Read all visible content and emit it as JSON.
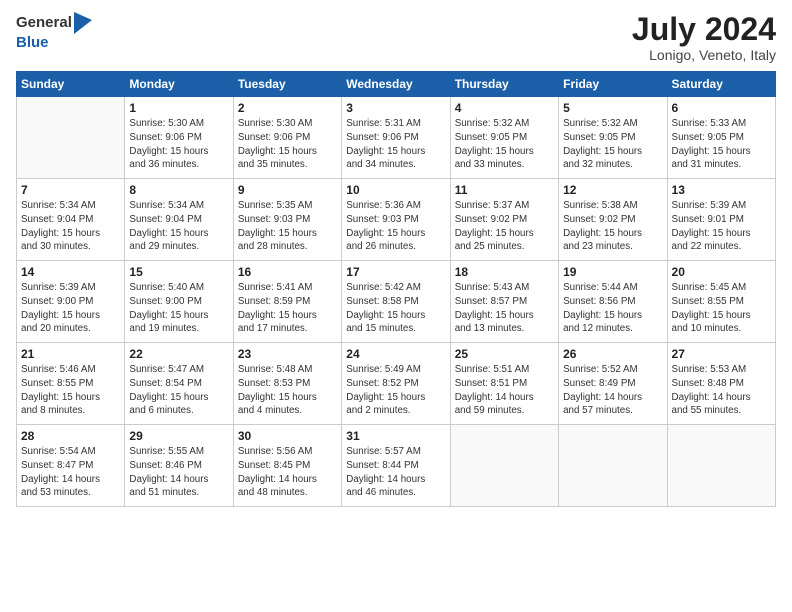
{
  "header": {
    "logo_line1": "General",
    "logo_line2": "Blue",
    "main_title": "July 2024",
    "subtitle": "Lonigo, Veneto, Italy"
  },
  "columns": [
    "Sunday",
    "Monday",
    "Tuesday",
    "Wednesday",
    "Thursday",
    "Friday",
    "Saturday"
  ],
  "weeks": [
    [
      {
        "day": "",
        "info": ""
      },
      {
        "day": "1",
        "info": "Sunrise: 5:30 AM\nSunset: 9:06 PM\nDaylight: 15 hours\nand 36 minutes."
      },
      {
        "day": "2",
        "info": "Sunrise: 5:30 AM\nSunset: 9:06 PM\nDaylight: 15 hours\nand 35 minutes."
      },
      {
        "day": "3",
        "info": "Sunrise: 5:31 AM\nSunset: 9:06 PM\nDaylight: 15 hours\nand 34 minutes."
      },
      {
        "day": "4",
        "info": "Sunrise: 5:32 AM\nSunset: 9:05 PM\nDaylight: 15 hours\nand 33 minutes."
      },
      {
        "day": "5",
        "info": "Sunrise: 5:32 AM\nSunset: 9:05 PM\nDaylight: 15 hours\nand 32 minutes."
      },
      {
        "day": "6",
        "info": "Sunrise: 5:33 AM\nSunset: 9:05 PM\nDaylight: 15 hours\nand 31 minutes."
      }
    ],
    [
      {
        "day": "7",
        "info": "Sunrise: 5:34 AM\nSunset: 9:04 PM\nDaylight: 15 hours\nand 30 minutes."
      },
      {
        "day": "8",
        "info": "Sunrise: 5:34 AM\nSunset: 9:04 PM\nDaylight: 15 hours\nand 29 minutes."
      },
      {
        "day": "9",
        "info": "Sunrise: 5:35 AM\nSunset: 9:03 PM\nDaylight: 15 hours\nand 28 minutes."
      },
      {
        "day": "10",
        "info": "Sunrise: 5:36 AM\nSunset: 9:03 PM\nDaylight: 15 hours\nand 26 minutes."
      },
      {
        "day": "11",
        "info": "Sunrise: 5:37 AM\nSunset: 9:02 PM\nDaylight: 15 hours\nand 25 minutes."
      },
      {
        "day": "12",
        "info": "Sunrise: 5:38 AM\nSunset: 9:02 PM\nDaylight: 15 hours\nand 23 minutes."
      },
      {
        "day": "13",
        "info": "Sunrise: 5:39 AM\nSunset: 9:01 PM\nDaylight: 15 hours\nand 22 minutes."
      }
    ],
    [
      {
        "day": "14",
        "info": "Sunrise: 5:39 AM\nSunset: 9:00 PM\nDaylight: 15 hours\nand 20 minutes."
      },
      {
        "day": "15",
        "info": "Sunrise: 5:40 AM\nSunset: 9:00 PM\nDaylight: 15 hours\nand 19 minutes."
      },
      {
        "day": "16",
        "info": "Sunrise: 5:41 AM\nSunset: 8:59 PM\nDaylight: 15 hours\nand 17 minutes."
      },
      {
        "day": "17",
        "info": "Sunrise: 5:42 AM\nSunset: 8:58 PM\nDaylight: 15 hours\nand 15 minutes."
      },
      {
        "day": "18",
        "info": "Sunrise: 5:43 AM\nSunset: 8:57 PM\nDaylight: 15 hours\nand 13 minutes."
      },
      {
        "day": "19",
        "info": "Sunrise: 5:44 AM\nSunset: 8:56 PM\nDaylight: 15 hours\nand 12 minutes."
      },
      {
        "day": "20",
        "info": "Sunrise: 5:45 AM\nSunset: 8:55 PM\nDaylight: 15 hours\nand 10 minutes."
      }
    ],
    [
      {
        "day": "21",
        "info": "Sunrise: 5:46 AM\nSunset: 8:55 PM\nDaylight: 15 hours\nand 8 minutes."
      },
      {
        "day": "22",
        "info": "Sunrise: 5:47 AM\nSunset: 8:54 PM\nDaylight: 15 hours\nand 6 minutes."
      },
      {
        "day": "23",
        "info": "Sunrise: 5:48 AM\nSunset: 8:53 PM\nDaylight: 15 hours\nand 4 minutes."
      },
      {
        "day": "24",
        "info": "Sunrise: 5:49 AM\nSunset: 8:52 PM\nDaylight: 15 hours\nand 2 minutes."
      },
      {
        "day": "25",
        "info": "Sunrise: 5:51 AM\nSunset: 8:51 PM\nDaylight: 14 hours\nand 59 minutes."
      },
      {
        "day": "26",
        "info": "Sunrise: 5:52 AM\nSunset: 8:49 PM\nDaylight: 14 hours\nand 57 minutes."
      },
      {
        "day": "27",
        "info": "Sunrise: 5:53 AM\nSunset: 8:48 PM\nDaylight: 14 hours\nand 55 minutes."
      }
    ],
    [
      {
        "day": "28",
        "info": "Sunrise: 5:54 AM\nSunset: 8:47 PM\nDaylight: 14 hours\nand 53 minutes."
      },
      {
        "day": "29",
        "info": "Sunrise: 5:55 AM\nSunset: 8:46 PM\nDaylight: 14 hours\nand 51 minutes."
      },
      {
        "day": "30",
        "info": "Sunrise: 5:56 AM\nSunset: 8:45 PM\nDaylight: 14 hours\nand 48 minutes."
      },
      {
        "day": "31",
        "info": "Sunrise: 5:57 AM\nSunset: 8:44 PM\nDaylight: 14 hours\nand 46 minutes."
      },
      {
        "day": "",
        "info": ""
      },
      {
        "day": "",
        "info": ""
      },
      {
        "day": "",
        "info": ""
      }
    ]
  ]
}
